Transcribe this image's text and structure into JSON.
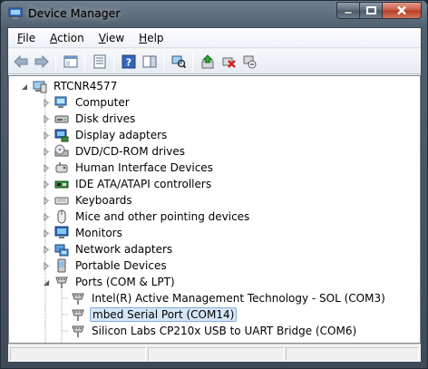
{
  "window": {
    "title": "Device Manager"
  },
  "menu": [
    {
      "label_u": "F",
      "label_rest": "ile"
    },
    {
      "label_u": "A",
      "label_rest": "ction"
    },
    {
      "label_u": "V",
      "label_rest": "iew"
    },
    {
      "label_u": "H",
      "label_rest": "elp"
    }
  ],
  "toolbar": [
    "back-icon",
    "forward-icon",
    "show-hide-tree-icon",
    "properties-icon",
    "help-icon",
    "action-pane-icon",
    "scan-hardware-icon",
    "update-driver-icon",
    "uninstall-icon",
    "disable-icon"
  ],
  "tree": {
    "root": "RTCNR4577",
    "categories": [
      {
        "label": "Computer",
        "icon": "computer-icon"
      },
      {
        "label": "Disk drives",
        "icon": "disk-drive-icon"
      },
      {
        "label": "Display adapters",
        "icon": "display-adapter-icon"
      },
      {
        "label": "DVD/CD-ROM drives",
        "icon": "dvd-drive-icon"
      },
      {
        "label": "Human Interface Devices",
        "icon": "hid-icon"
      },
      {
        "label": "IDE ATA/ATAPI controllers",
        "icon": "ide-controller-icon"
      },
      {
        "label": "Keyboards",
        "icon": "keyboard-icon"
      },
      {
        "label": "Mice and other pointing devices",
        "icon": "mouse-icon"
      },
      {
        "label": "Monitors",
        "icon": "monitor-icon"
      },
      {
        "label": "Network adapters",
        "icon": "network-adapter-icon"
      },
      {
        "label": "Portable Devices",
        "icon": "portable-device-icon"
      },
      {
        "label": "Ports (COM & LPT)",
        "icon": "port-icon"
      }
    ],
    "ports": [
      {
        "label": "Intel(R) Active Management Technology - SOL (COM3)"
      },
      {
        "label": "mbed Serial Port (COM14)"
      },
      {
        "label": "Silicon Labs CP210x USB to UART Bridge (COM6)"
      }
    ]
  },
  "colors": {
    "selection": "#d6e6f7",
    "selection_border": "#84acdd",
    "tree_line": "#a0a0a0"
  }
}
